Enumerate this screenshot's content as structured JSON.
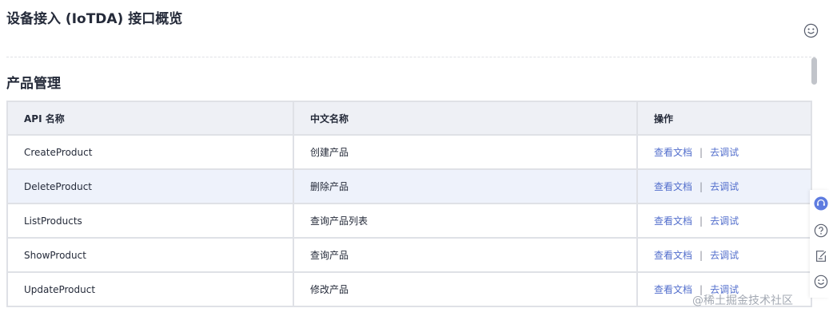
{
  "header": {
    "title": "设备接入 (IoTDA) 接口概览",
    "feedback_icon": "smiley-face-icon"
  },
  "section": {
    "title": "产品管理"
  },
  "table": {
    "columns": [
      "API 名称",
      "中文名称",
      "操作"
    ],
    "rows": [
      {
        "api": "CreateProduct",
        "name": "创建产品",
        "doc": "查看文档",
        "sep": "|",
        "debug": "去调试"
      },
      {
        "api": "DeleteProduct",
        "name": "删除产品",
        "doc": "查看文档",
        "sep": "|",
        "debug": "去调试"
      },
      {
        "api": "ListProducts",
        "name": "查询产品列表",
        "doc": "查看文档",
        "sep": "|",
        "debug": "去调试"
      },
      {
        "api": "ShowProduct",
        "name": "查询产品",
        "doc": "查看文档",
        "sep": "|",
        "debug": "去调试"
      },
      {
        "api": "UpdateProduct",
        "name": "修改产品",
        "doc": "查看文档",
        "sep": "|",
        "debug": "去调试"
      }
    ],
    "highlighted_row": 1
  },
  "float_toolbar": {
    "icons": [
      "customer-service-icon",
      "help-icon",
      "note-edit-icon",
      "smiley-face-icon"
    ]
  },
  "watermark": "@稀土掘金技术社区",
  "colors": {
    "link": "#526ecc",
    "header_bg": "#eef0f5",
    "highlight_row_bg": "#eef2fb",
    "service_icon": "#5e7ce0"
  }
}
